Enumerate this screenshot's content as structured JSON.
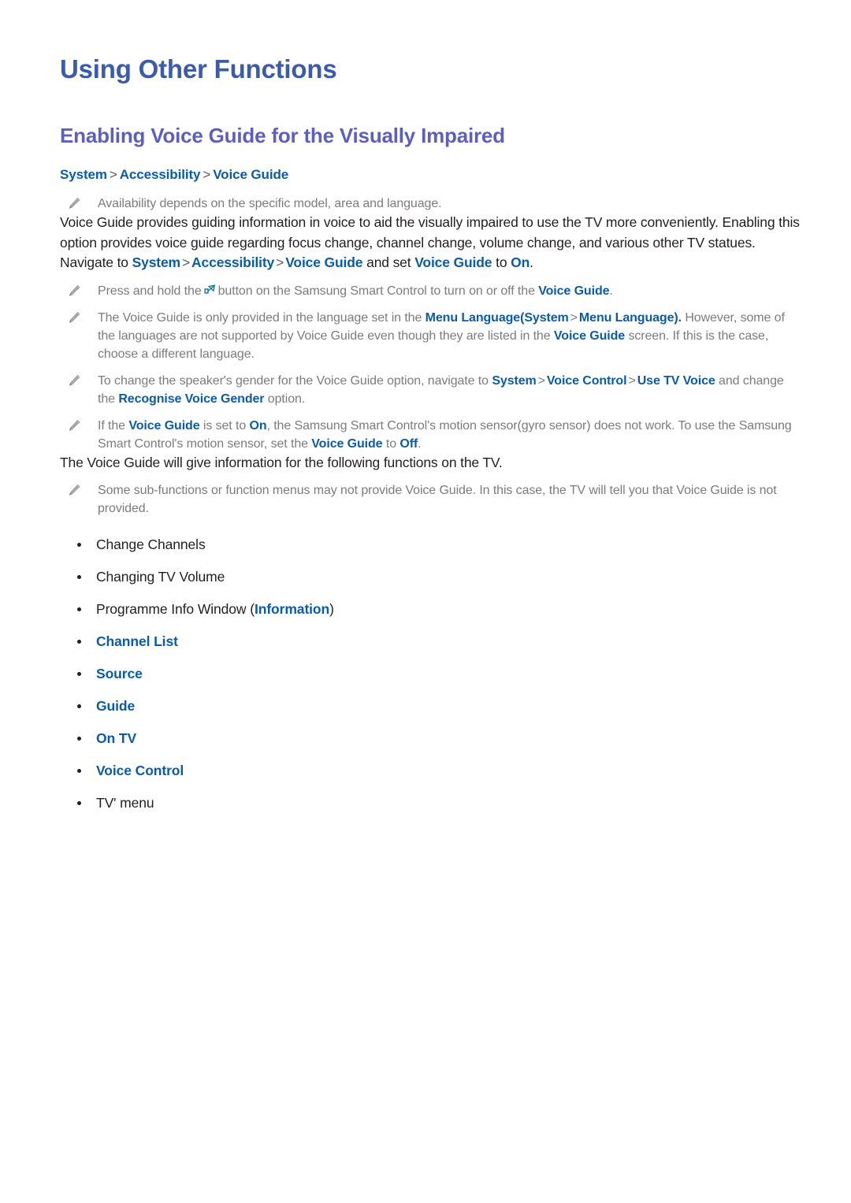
{
  "document": {
    "title": "Using Other Functions",
    "section_title": "Enabling Voice Guide for the Visually Impaired"
  },
  "breadcrumb": {
    "items": [
      "System",
      "Accessibility",
      "Voice Guide"
    ],
    "separator": ">"
  },
  "notes": {
    "availability": "Availability depends on the specific model, area and language.",
    "press_hold_pre": "Press and hold the",
    "press_hold_mid": "button on the Samsung Smart Control to turn on or off the",
    "press_hold_ref": "Voice Guide",
    "press_hold_end": ".",
    "language_1": "The Voice Guide is only provided in the language set in the",
    "language_ref_1": "Menu Language",
    "language_paren_open": "(",
    "language_ref_2": "System",
    "language_sep": ">",
    "language_ref_3": "Menu Language",
    "language_paren_close": ").",
    "language_2": "However, some of the languages are not supported by Voice Guide even though they are listed in the",
    "language_ref_4": "Voice Guide",
    "language_3": "screen. If this is the case, choose a different language.",
    "gender_1": "To change the speaker's gender for the Voice Guide option, navigate to",
    "gender_ref_1": "System",
    "gender_sep_1": ">",
    "gender_ref_2": "Voice Control",
    "gender_sep_2": ">",
    "gender_ref_3": "Use TV Voice",
    "gender_2": "and change the",
    "gender_ref_4": "Recognise Voice Gender",
    "gender_3": "option.",
    "motion_1": "If the",
    "motion_ref_1": "Voice Guide",
    "motion_2": "is set to",
    "motion_ref_2": "On",
    "motion_3": ", the Samsung Smart Control's motion sensor(gyro sensor) does not work. To use the Samsung Smart Control's motion sensor, set the",
    "motion_ref_3": "Voice Guide",
    "motion_4": "to",
    "motion_ref_4": "Off",
    "motion_5": ".",
    "subfunctions": "Some sub-functions or function menus may not provide Voice Guide. In this case, the TV will tell you that Voice Guide is not provided."
  },
  "paragraphs": {
    "intro": "Voice Guide provides guiding information in voice to aid the visually impaired to use the TV more conveniently. Enabling this option provides voice guide regarding focus change, channel change, volume change, and various other TV statues.",
    "navigate_pre": "Navigate to",
    "navigate_ref_1": "System",
    "navigate_sep_1": ">",
    "navigate_ref_2": "Accessibility",
    "navigate_sep_2": ">",
    "navigate_ref_3": "Voice Guide",
    "navigate_mid": "and set",
    "navigate_ref_4": "Voice Guide",
    "navigate_to": "to",
    "navigate_ref_5": "On",
    "navigate_end": ".",
    "following": "The Voice Guide will give information for the following functions on the TV."
  },
  "function_list": [
    {
      "text": "Change Channels",
      "style": "plain"
    },
    {
      "text": "Changing TV Volume",
      "style": "plain"
    },
    {
      "text": "Programme Info Window (",
      "style": "mixed",
      "link": "Information",
      "tail": ")"
    },
    {
      "text": "Channel List",
      "style": "link"
    },
    {
      "text": "Source",
      "style": "link"
    },
    {
      "text": "Guide",
      "style": "link"
    },
    {
      "text": "On TV",
      "style": "link"
    },
    {
      "text": "Voice Control",
      "style": "link"
    },
    {
      "text": "TV' menu",
      "style": "plain"
    }
  ],
  "icons": {
    "note": "pencil-icon",
    "voice_button": "voice-button-icon"
  },
  "colors": {
    "title_blue": "#3c5ba9",
    "section_purple": "#5d5fbe",
    "menu_ref_blue": "#0b5ca8",
    "note_gray": "#7a7c80",
    "body_black": "#231f20",
    "icon_teal": "#1b7fa3"
  }
}
